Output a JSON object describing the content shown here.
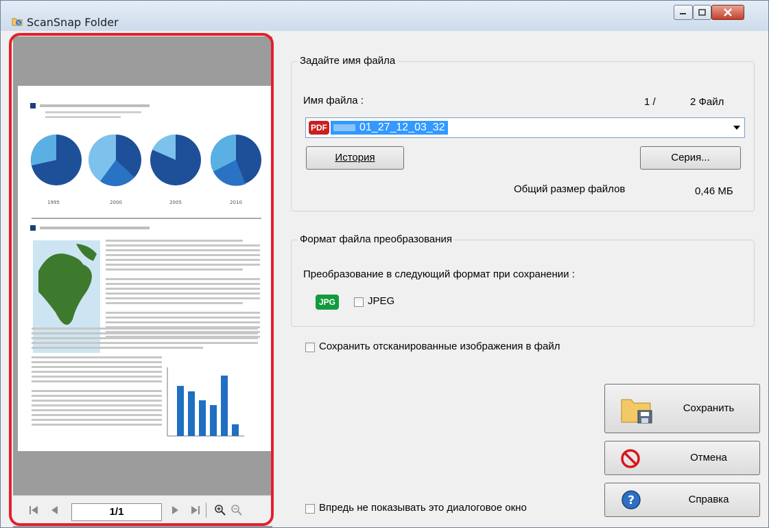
{
  "window": {
    "title": "ScanSnap Folder"
  },
  "preview": {
    "page_counter": "1/1",
    "years": [
      "1995",
      "2000",
      "2005",
      "2010"
    ]
  },
  "filename_group": {
    "title": "Задайте имя файла",
    "filename_label": "Имя файла :",
    "file_index": "1 /",
    "file_count": "2 Файл",
    "filename_value": "01_27_12_03_32",
    "file_badge": "PDF",
    "history_button": "История",
    "series_button": "Серия...",
    "total_size_label": "Общий размер файлов",
    "total_size_value": "0,46 МБ"
  },
  "format_group": {
    "title": "Формат файла преобразования",
    "conversion_label": "Преобразование в следующий формат при сохранении :",
    "jpg_badge": "JPG",
    "jpeg_option": "JPEG"
  },
  "save_images_option": "Сохранить отсканированные изображения в файл",
  "dont_show_option": "Впредь не показывать это диалоговое окно",
  "buttons": {
    "save": "Сохранить",
    "cancel": "Отмена",
    "help": "Справка"
  },
  "colors": {
    "highlight": "#e3202b",
    "selection": "#3399ff",
    "pdf_badge": "#c91f1f",
    "jpg_badge": "#139a3c"
  }
}
